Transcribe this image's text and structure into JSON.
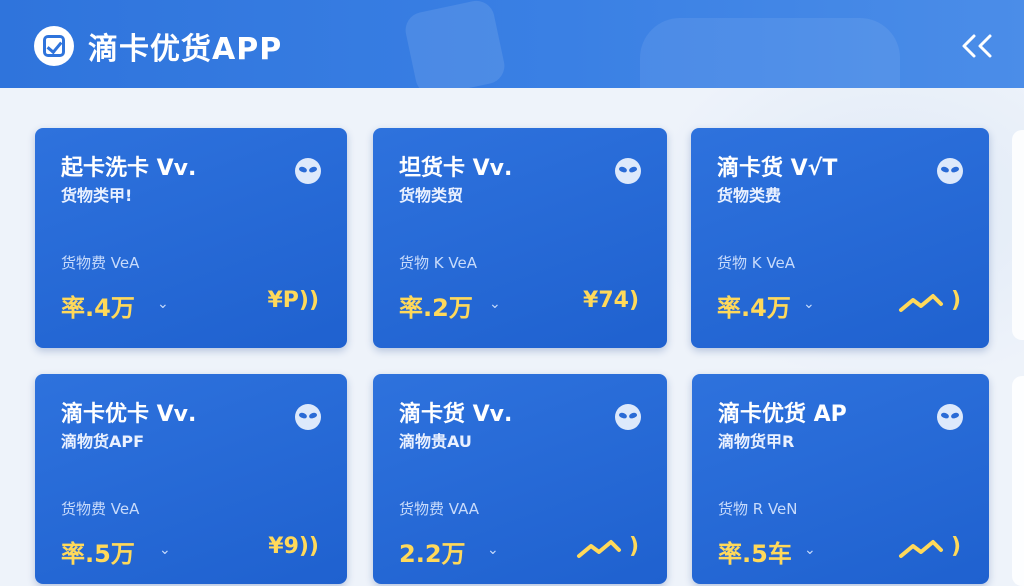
{
  "app": {
    "title": "滴卡优货APP",
    "back_glyph": "<<"
  },
  "icons": {
    "logo": "check-badge-icon",
    "back": "back-chevron-icon",
    "card_badge": "alien-icon",
    "trend": "trend-zigzag-icon",
    "chevron": "chevron-down-icon"
  },
  "colors": {
    "header": "#2f74dc",
    "card": "#2166d3",
    "accent": "#ffd95a"
  },
  "cards": [
    {
      "title": "起卡洗卡 Vⅴ.",
      "subtitle": "货物类甲!",
      "label": "货物费 VeA",
      "amount": "率.4万",
      "right": "¥P))",
      "trend": false
    },
    {
      "title": "坦货卡 Vⅴ.",
      "subtitle": "货物类贸",
      "label": "货物 K VeA",
      "amount": "率.2万",
      "right": "¥74)",
      "trend": false
    },
    {
      "title": "滴卡货 V√T",
      "subtitle": "货物类费",
      "label": "货物 K VeA",
      "amount": "率.4万",
      "right": ")",
      "trend": true
    },
    {
      "title": "滴卡优卡 Vⅴ.",
      "subtitle": "滴物货APF",
      "label": "货物费 VeA",
      "amount": "率.5万",
      "right": "¥9))",
      "trend": false
    },
    {
      "title": "滴卡货 Vⅴ.",
      "subtitle": "滴物贵AU",
      "label": "货物费 VAA",
      "amount": "2.2万",
      "right": ")",
      "trend": true
    },
    {
      "title": "滴卡优货 AP",
      "subtitle": "滴物货甲R",
      "label": "货物 R VeN",
      "amount": "率.5车",
      "right": ")",
      "trend": true
    }
  ]
}
